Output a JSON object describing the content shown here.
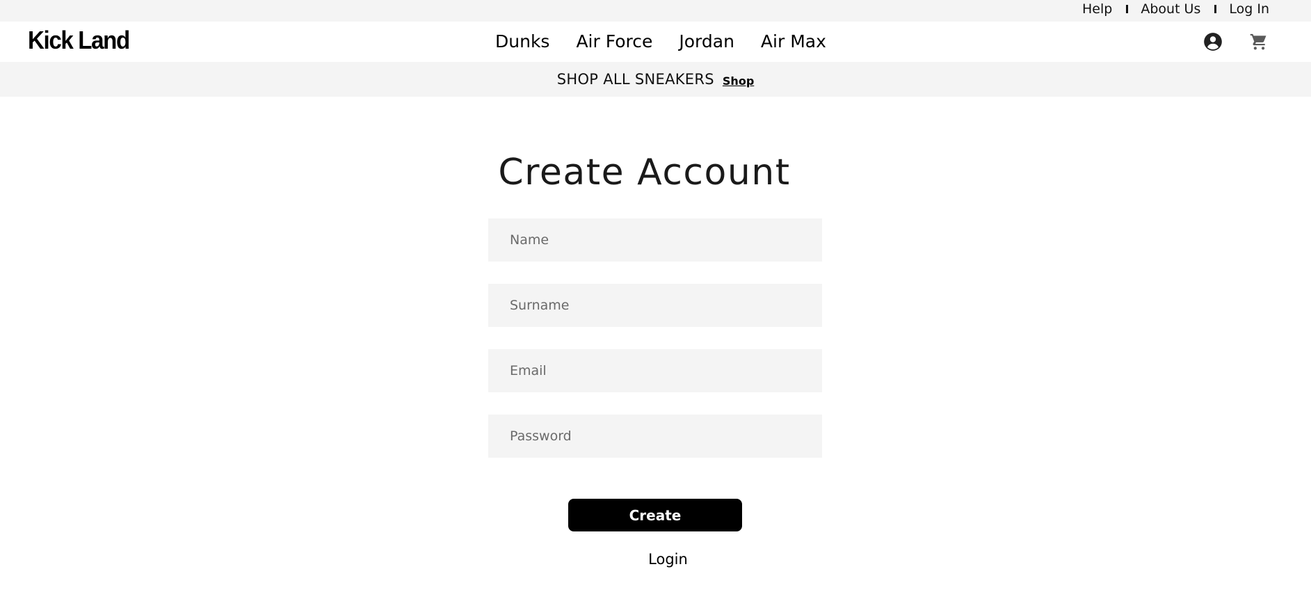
{
  "utility": {
    "links": [
      "Help",
      "About Us",
      "Log In"
    ]
  },
  "header": {
    "logo": "Kick Land",
    "nav": [
      "Dunks",
      "Air Force",
      "Jordan",
      "Air Max"
    ],
    "icons": [
      "account-circle-icon",
      "shopping-cart-icon"
    ]
  },
  "promo": {
    "text": "SHOP ALL SNEAKERS",
    "link": "Shop"
  },
  "form": {
    "title": "Create Account",
    "name_placeholder": "Name",
    "surname_placeholder": "Surname",
    "email_placeholder": "Email",
    "password_placeholder": "Password",
    "submit_label": "Create",
    "login_label": "Login"
  },
  "colors": {
    "bar_background": "#f4f4f4",
    "button_background": "#000000",
    "button_text": "#ffffff"
  }
}
